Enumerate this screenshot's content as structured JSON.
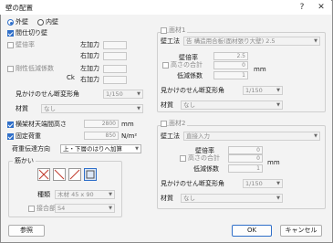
{
  "window": {
    "title": "壁の配置",
    "help": "?",
    "close": "✕"
  },
  "left": {
    "radio_outer": "外壁",
    "radio_inner": "内壁",
    "partition_label": "間仕切り壁",
    "wall_ratio_label": "壁倍率",
    "force_left_1": "左加力",
    "force_right_1": "右加力",
    "stiffness_label": "剛性低減係数",
    "stiffness_sub": "Ck",
    "force_left_2": "左加力",
    "force_right_2": "右加力",
    "apparent_section_label": "見かけのせん断変形角",
    "apparent_section_value": "1/150",
    "material_label": "材質",
    "material_value": "なし",
    "beam_height_label": "横架材天端間高さ",
    "beam_height_value": "2800",
    "beam_height_unit": "mm",
    "fixed_load_label": "固定荷重",
    "fixed_load_value": "850",
    "fixed_load_unit": "N/m²",
    "load_dir_label": "荷重伝達方向",
    "load_dir_value": "上・下層のはりへ加算",
    "brace_group_label": "筋かい",
    "brace_type_label": "種類",
    "brace_type_value": "木材 45 x 90",
    "brace_joint_label": "接合部",
    "brace_joint_value": "S4"
  },
  "panel1": {
    "group_label": "面材1",
    "method_label": "壁工法",
    "method_value": "告 構造用合板(面材張り大壁) 2.5",
    "wall_ratio_label": "壁倍率",
    "wall_ratio_value": "2.5",
    "total_height_label": "高さの合計",
    "total_height_value": "0",
    "total_height_unit": "mm",
    "reduction_label": "低減係数",
    "reduction_value": "1",
    "apparent_label": "見かけのせん断変形角",
    "apparent_value": "1/150",
    "material_label": "材質",
    "material_value": "なし"
  },
  "panel2": {
    "group_label": "面材2",
    "method_label": "壁工法",
    "method_value": "直接入力",
    "wall_ratio_label": "壁倍率",
    "wall_ratio_value": "0",
    "total_height_label": "高さの合計",
    "total_height_value": "0",
    "total_height_unit": "mm",
    "reduction_label": "低減係数",
    "reduction_value": "1",
    "apparent_label": "見かけのせん断変形角",
    "apparent_value": "1/150",
    "material_label": "材質",
    "material_value": "なし"
  },
  "buttons": {
    "reference": "参照",
    "ok": "OK",
    "cancel": "キャンセル"
  },
  "colors": {
    "accent": "#2f6fc9",
    "disabled_text": "#8a8a8a"
  }
}
